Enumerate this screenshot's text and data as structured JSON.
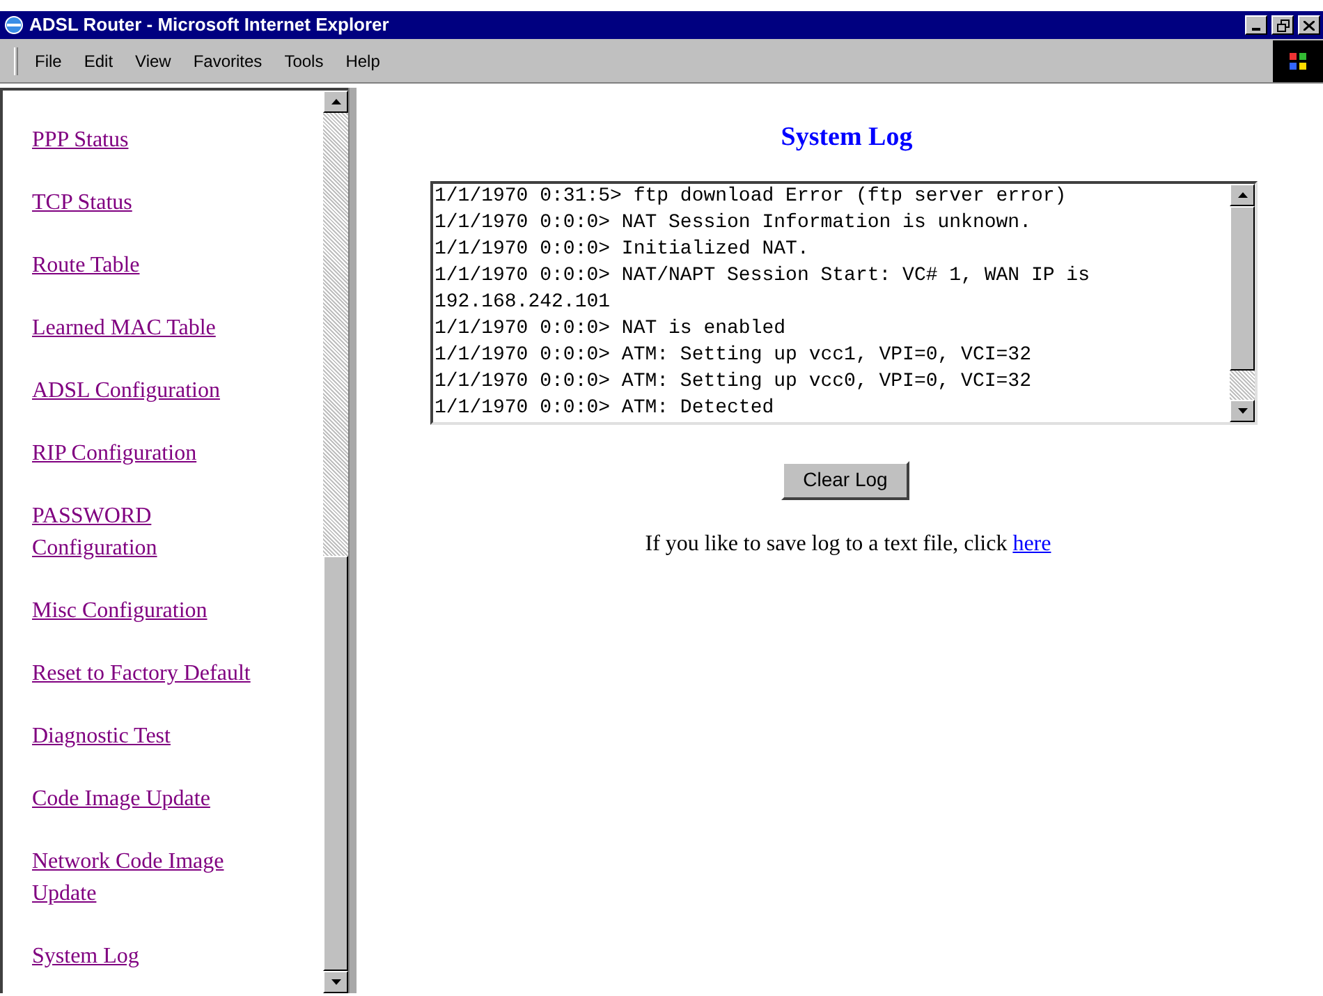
{
  "window": {
    "title": "ADSL Router - Microsoft Internet Explorer"
  },
  "menu": [
    "File",
    "Edit",
    "View",
    "Favorites",
    "Tools",
    "Help"
  ],
  "sidebar": {
    "items": [
      "PPP Status",
      "TCP Status",
      "Route Table",
      "Learned MAC Table",
      "ADSL Configuration",
      "RIP Configuration",
      "PASSWORD Configuration",
      "Misc Configuration",
      "Reset to Factory Default",
      "Diagnostic Test",
      "Code Image Update",
      "Network Code Image Update",
      "System Log"
    ]
  },
  "main": {
    "heading": "System Log",
    "log": [
      "1/1/1970 0:31:5> ftp download Error (ftp server error)",
      "1/1/1970 0:0:0> NAT Session Information is unknown.",
      "1/1/1970 0:0:0> Initialized NAT.",
      "1/1/1970 0:0:0> NAT/NAPT Session Start: VC# 1, WAN IP is 192.168.242.101",
      "1/1/1970 0:0:0> NAT is enabled",
      "1/1/1970 0:0:0> ATM: Setting up vcc1, VPI=0, VCI=32",
      "1/1/1970 0:0:0> ATM: Setting up vcc0, VPI=0, VCI=32",
      "1/1/1970 0:0:0> ATM: Detected"
    ],
    "button": "Clear Log",
    "save_text": "If you like to save log to a text file, click",
    "save_link": "here"
  }
}
